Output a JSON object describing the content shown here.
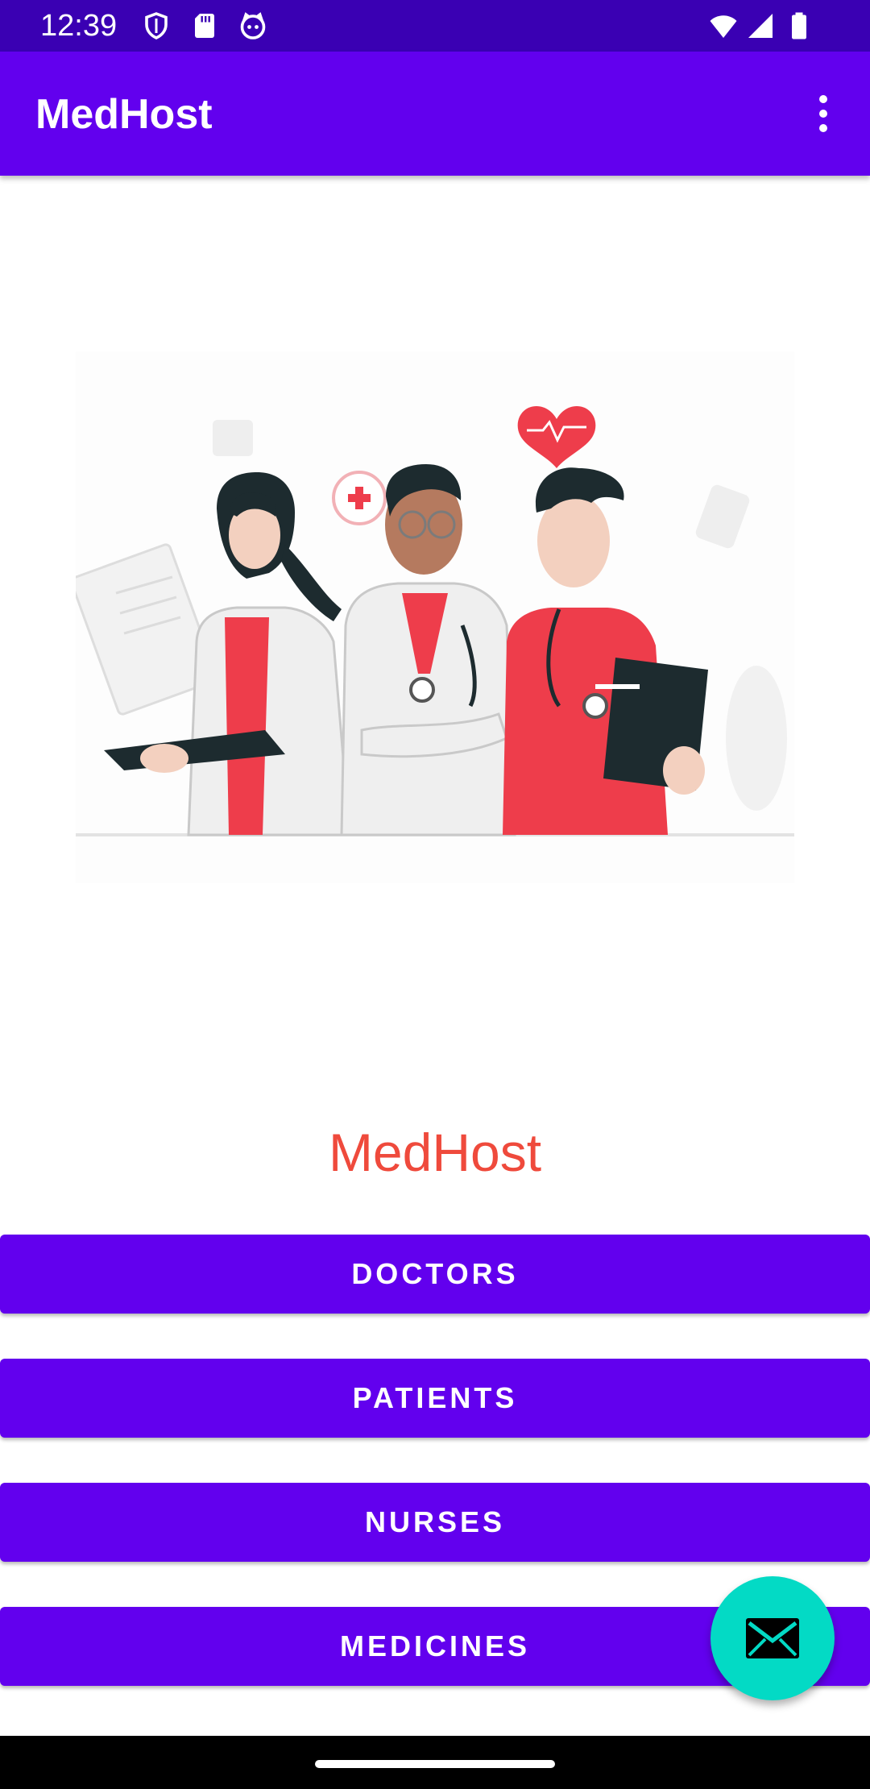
{
  "status_bar": {
    "time": "12:39",
    "icons": [
      "shield-icon",
      "sd-card-icon",
      "cat-icon",
      "wifi-icon",
      "cell-signal-icon",
      "battery-icon"
    ],
    "background": "#3a00b3"
  },
  "app_bar": {
    "title": "MedHost",
    "menu_icon": "more-vert-icon",
    "background": "#6200ee"
  },
  "illustration": {
    "icon": "medical-staff-illustration"
  },
  "main": {
    "title": "MedHost",
    "title_color": "#ef4a3c",
    "buttons": [
      {
        "label": "DOCTORS"
      },
      {
        "label": "PATIENTS"
      },
      {
        "label": "NURSES"
      },
      {
        "label": "MEDICINES"
      }
    ],
    "button_color": "#6200ee"
  },
  "fab": {
    "icon": "mail-icon",
    "color": "#03dac5"
  }
}
